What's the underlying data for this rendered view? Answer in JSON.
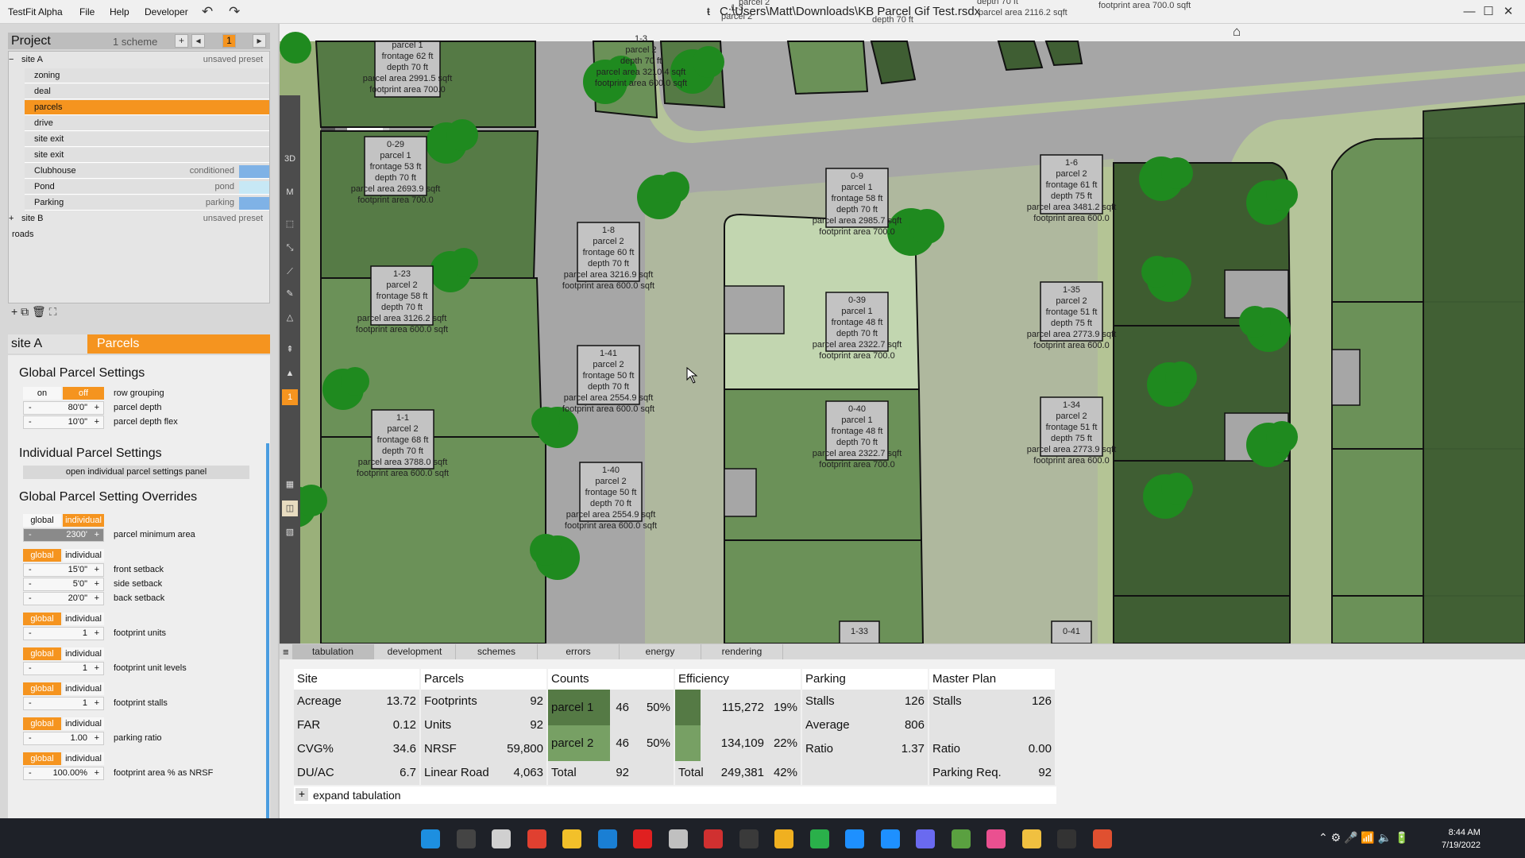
{
  "titlebar": {
    "app": "TestFit Alpha",
    "menu": [
      "File",
      "Help",
      "Developer"
    ],
    "path": "C:\\Users\\Matt\\Downloads\\KB Parcel Gif Test.rsdx",
    "ghost": [
      "parcel 2",
      "depth 70 ft",
      "parcel area 2116.2 sqft",
      "footprint area 700.0 sqft",
      "1-3",
      "parcel 2",
      "depth 70 ft"
    ],
    "undo": "↶",
    "redo": "↷",
    "min": "—",
    "max": "☐",
    "close": "✕",
    "home": "⌂"
  },
  "project": {
    "title": "Project",
    "schemes": "1 scheme",
    "num": "1",
    "add": "+",
    "prev": "◂",
    "next": "▸",
    "tree": [
      {
        "label": "site A",
        "right": "unsaved preset",
        "indent": 0,
        "prefix": "−"
      },
      {
        "label": "zoning",
        "indent": 1
      },
      {
        "label": "deal",
        "indent": 1
      },
      {
        "label": "parcels",
        "indent": 1,
        "selected": true
      },
      {
        "label": "drive",
        "indent": 1
      },
      {
        "label": "site exit",
        "indent": 1
      },
      {
        "label": "site exit",
        "indent": 1
      },
      {
        "label": "Clubhouse",
        "right": "conditioned",
        "indent": 1,
        "swatch": "#7fb2e6"
      },
      {
        "label": "Pond",
        "right": "pond",
        "indent": 1,
        "swatch": "#c7e8f5"
      },
      {
        "label": "Parking",
        "right": "parking",
        "indent": 1,
        "swatch": "#7fb2e6"
      },
      {
        "label": "site B",
        "right": "unsaved preset",
        "indent": 0,
        "prefix": "+"
      },
      {
        "label": "roads",
        "indent": 0
      }
    ],
    "tree_buttons": "+ ⧉ 🗑 ⛶"
  },
  "panel": {
    "site": "site A",
    "title": "Parcels"
  },
  "settings": {
    "global_title": "Global Parcel Settings",
    "row_grouping": {
      "on": "on",
      "off": "off",
      "label": "row grouping"
    },
    "parcel_depth": {
      "value": "80'0\"",
      "label": "parcel depth"
    },
    "depth_flex": {
      "value": "10'0\"",
      "label": "parcel depth flex"
    },
    "individual_title": "Individual Parcel Settings",
    "open_panel": "open individual parcel settings panel",
    "overrides_title": "Global Parcel Setting Overrides",
    "min_area": {
      "value": "2300'",
      "label": "parcel minimum area"
    },
    "front_setback": {
      "value": "15'0\"",
      "label": "front setback"
    },
    "side_setback": {
      "value": "5'0\"",
      "label": "side setback"
    },
    "back_setback": {
      "value": "20'0\"",
      "label": "back setback"
    },
    "footprint_units": {
      "value": "1",
      "label": "footprint units"
    },
    "footprint_unit_levels": {
      "value": "1",
      "label": "footprint unit levels"
    },
    "footprint_stalls": {
      "value": "1",
      "label": "footprint stalls"
    },
    "parking_ratio": {
      "value": "1.00",
      "label": "parking ratio"
    },
    "footprint_nrsf": {
      "value": "100.00%",
      "label": "footprint area % as NRSF"
    },
    "global": "global",
    "individual": "individual",
    "minus": "-",
    "plus": "+"
  },
  "tools": [
    "3D",
    "M",
    "1"
  ],
  "parcels": [
    {
      "id": "parcel 1",
      "lines": [
        "parcel 1",
        "frontage 62 ft",
        "depth 70 ft",
        "parcel area 2991.5 sqft",
        "footprint area 700.0"
      ]
    },
    {
      "id": "0-29",
      "lines": [
        "0-29",
        "parcel 1",
        "frontage 53 ft",
        "depth 70 ft",
        "parcel area 2693.9 sqft",
        "footprint area 700.0"
      ]
    },
    {
      "id": "1-23",
      "lines": [
        "1-23",
        "parcel 2",
        "frontage 58 ft",
        "depth 70 ft",
        "parcel area 3126.2 sqft",
        "footprint area 600.0 sqft"
      ]
    },
    {
      "id": "1-1",
      "lines": [
        "1-1",
        "parcel 2",
        "frontage 68 ft",
        "depth 70 ft",
        "parcel area 3788.0 sqft",
        "footprint area 600.0 sqft"
      ]
    },
    {
      "id": "1-8",
      "lines": [
        "1-8",
        "parcel 2",
        "frontage 60 ft",
        "depth 70 ft",
        "parcel area 3216.9 sqft",
        "footprint area 600.0 sqft"
      ]
    },
    {
      "id": "1-41",
      "lines": [
        "1-41",
        "parcel 2",
        "frontage 50 ft",
        "depth 70 ft",
        "parcel area 2554.9 sqft",
        "footprint area 600.0 sqft"
      ]
    },
    {
      "id": "1-40",
      "lines": [
        "1-40",
        "parcel 2",
        "frontage 50 ft",
        "depth 70 ft",
        "parcel area 2554.9 sqft",
        "footprint area 600.0 sqft"
      ]
    },
    {
      "id": "0-9",
      "lines": [
        "0-9",
        "parcel 1",
        "frontage 58 ft",
        "depth 70 ft",
        "parcel area 2985.7 sqft",
        "footprint area 700.0"
      ]
    },
    {
      "id": "0-39",
      "lines": [
        "0-39",
        "parcel 1",
        "frontage 48 ft",
        "depth 70 ft",
        "parcel area 2322.7 sqft",
        "footprint area 700.0"
      ]
    },
    {
      "id": "0-40",
      "lines": [
        "0-40",
        "parcel 1",
        "frontage 48 ft",
        "depth 70 ft",
        "parcel area 2322.7 sqft",
        "footprint area 700.0"
      ]
    },
    {
      "id": "1-6",
      "lines": [
        "1-6",
        "parcel 2",
        "frontage 61 ft",
        "depth 75 ft",
        "parcel area 3481.2 sqft",
        "footprint area 600.0"
      ]
    },
    {
      "id": "1-35",
      "lines": [
        "1-35",
        "parcel 2",
        "frontage 51 ft",
        "depth 75 ft",
        "parcel area 2773.9 sqft",
        "footprint area 600.0"
      ]
    },
    {
      "id": "1-34",
      "lines": [
        "1-34",
        "parcel 2",
        "frontage 51 ft",
        "depth 75 ft",
        "parcel area 2773.9 sqft",
        "footprint area 600.0"
      ]
    },
    {
      "id": "top1",
      "lines": [
        "1-3",
        "parcel 2",
        "depth 70 ft",
        "parcel area 3210.4 sqft",
        "footprint area 600.0 sqft"
      ]
    },
    {
      "id": "0-41",
      "lines": [
        "0-41"
      ]
    },
    {
      "id": "1-33",
      "lines": [
        "1-33"
      ]
    }
  ],
  "tabs": [
    "tabulation",
    "development",
    "schemes",
    "errors",
    "energy",
    "rendering"
  ],
  "tabulation": {
    "site": {
      "h": "Site",
      "rows": [
        [
          "Acreage",
          "13.72"
        ],
        [
          "FAR",
          "0.12"
        ],
        [
          "CVG%",
          "34.6"
        ],
        [
          "DU/AC",
          "6.7"
        ]
      ]
    },
    "parcels": {
      "h": "Parcels",
      "rows": [
        [
          "Footprints",
          "92"
        ],
        [
          "Units",
          "92"
        ],
        [
          "NRSF",
          "59,800"
        ],
        [
          "Linear Road",
          "4,063"
        ]
      ]
    },
    "counts": {
      "h": "Counts",
      "rows": [
        [
          "parcel 1",
          "46",
          "50%"
        ],
        [
          "parcel 2",
          "46",
          "50%"
        ],
        [
          "Total",
          "92",
          ""
        ]
      ]
    },
    "efficiency": {
      "h": "Efficiency",
      "rows": [
        [
          "",
          "115,272",
          "19%"
        ],
        [
          "",
          "134,109",
          "22%"
        ],
        [
          "Total",
          "249,381",
          "42%"
        ]
      ]
    },
    "parking": {
      "h": "Parking",
      "rows": [
        [
          "Stalls",
          "126"
        ],
        [
          "Average",
          "806"
        ],
        [
          "Ratio",
          "1.37"
        ],
        [
          "",
          ""
        ]
      ]
    },
    "master": {
      "h": "Master Plan",
      "rows": [
        [
          "Stalls",
          "126"
        ],
        [
          "",
          ""
        ],
        [
          "Ratio",
          "0.00"
        ],
        [
          "Parking Req.",
          "92"
        ]
      ]
    },
    "expand": "expand tabulation"
  },
  "clock": {
    "time": "8:44 AM",
    "date": "7/19/2022"
  }
}
